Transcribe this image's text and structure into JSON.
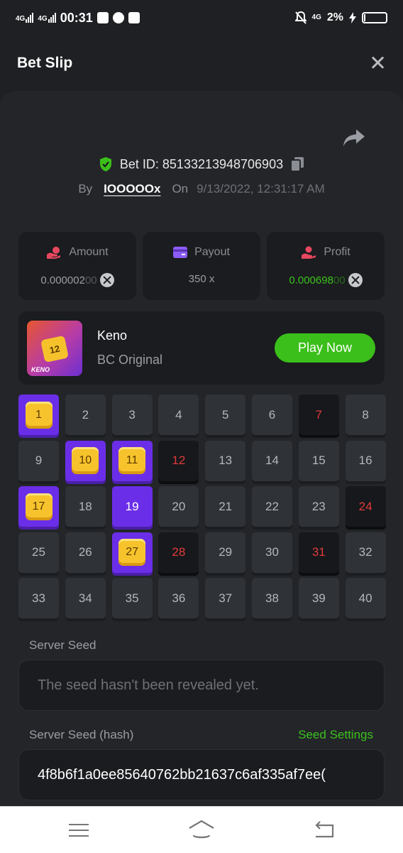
{
  "status_bar": {
    "signal1": "4G",
    "signal2": "4G",
    "time": "00:31",
    "signal3": "4G",
    "battery": "2%"
  },
  "header": {
    "title": "Bet Slip"
  },
  "bet": {
    "id_text": "Bet ID: 85133213948706903",
    "by_label": "By",
    "user": "IOOOOOx",
    "on_label": "On",
    "date": "9/13/2022, 12:31:17 AM"
  },
  "stats": {
    "amount": {
      "label": "Amount",
      "value_main": "0.000002",
      "value_faded": "00",
      "icon": "coin-hand-icon",
      "icon_color": "#e8485f"
    },
    "payout": {
      "label": "Payout",
      "value": "350 x",
      "icon": "card-icon",
      "icon_color": "#8b5cf6"
    },
    "profit": {
      "label": "Profit",
      "value_main": "0.000698",
      "value_faded": "00",
      "icon": "hand-coin-icon",
      "icon_color": "#e8485f"
    }
  },
  "game": {
    "thumb_number": "12",
    "thumb_label": "KENO",
    "name": "Keno",
    "provider": "BC Original",
    "play_label": "Play Now"
  },
  "grid": {
    "numbers": [
      "1",
      "2",
      "3",
      "4",
      "5",
      "6",
      "7",
      "8",
      "9",
      "10",
      "11",
      "12",
      "13",
      "14",
      "15",
      "16",
      "17",
      "18",
      "19",
      "20",
      "21",
      "22",
      "23",
      "24",
      "25",
      "26",
      "27",
      "28",
      "29",
      "30",
      "31",
      "32",
      "33",
      "34",
      "35",
      "36",
      "37",
      "38",
      "39",
      "40"
    ],
    "hits": [
      1,
      10,
      11,
      17,
      27
    ],
    "picks": [
      19
    ],
    "misses": [
      7,
      12,
      24,
      28,
      31
    ]
  },
  "seed": {
    "server_label": "Server Seed",
    "server_value": "The seed hasn't been revealed yet.",
    "hash_label": "Server Seed (hash)",
    "settings_label": "Seed Settings",
    "hash_value": "4f8b6f1a0ee85640762bb21637c6af335af7ee("
  },
  "colors": {
    "accent_green": "#3bbf1a",
    "pick_purple": "#6b2ee8",
    "miss_red": "#e03b3b",
    "gem_gold": "#f7c32c"
  }
}
